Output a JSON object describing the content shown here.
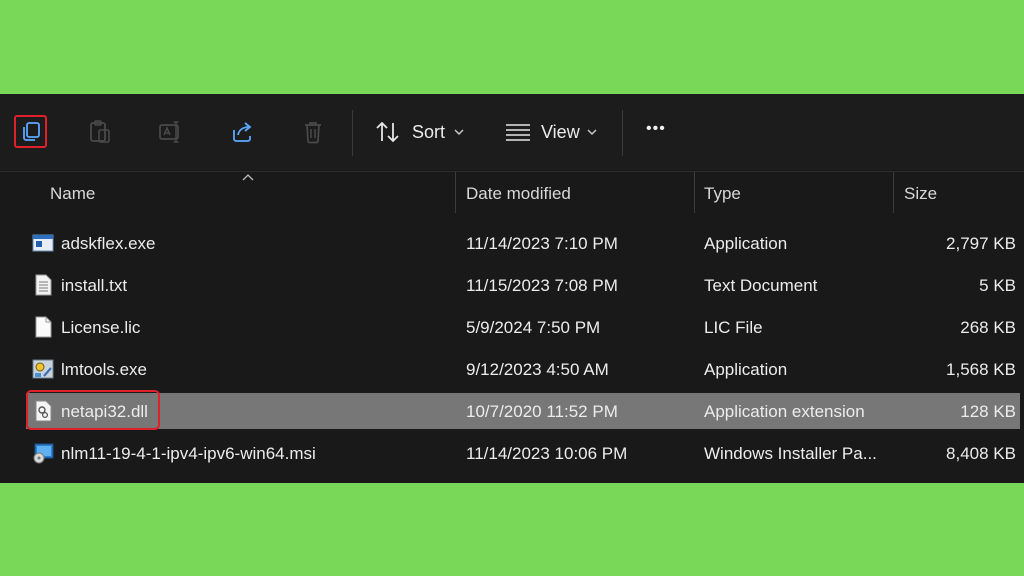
{
  "toolbar": {
    "buttons": [
      "copy-icon",
      "paste-icon",
      "rename-icon",
      "share-icon",
      "delete-icon"
    ],
    "sort_label": "Sort",
    "view_label": "View",
    "more_label": "•••"
  },
  "columns": {
    "name": "Name",
    "date": "Date modified",
    "type": "Type",
    "size": "Size"
  },
  "files": [
    {
      "name": "adskflex.exe",
      "date": "11/14/2023 7:10 PM",
      "type": "Application",
      "size": "2,797 KB",
      "icon": "exe-window-icon"
    },
    {
      "name": "install.txt",
      "date": "11/15/2023 7:08 PM",
      "type": "Text Document",
      "size": "5 KB",
      "icon": "text-file-icon"
    },
    {
      "name": "License.lic",
      "date": "5/9/2024 7:50 PM",
      "type": "LIC File",
      "size": "268 KB",
      "icon": "blank-file-icon"
    },
    {
      "name": "lmtools.exe",
      "date": "9/12/2023 4:50 AM",
      "type": "Application",
      "size": "1,568 KB",
      "icon": "tools-app-icon"
    },
    {
      "name": "netapi32.dll",
      "date": "10/7/2020 11:52 PM",
      "type": "Application extension",
      "size": "128 KB",
      "icon": "dll-gear-icon",
      "selected": true
    },
    {
      "name": "nlm11-19-4-1-ipv4-ipv6-win64.msi",
      "date": "11/14/2023 10:06 PM",
      "type": "Windows Installer Pa...",
      "size": "8,408 KB",
      "icon": "msi-installer-icon"
    }
  ],
  "colors": {
    "background_green": "#7ad858",
    "panel": "#191919",
    "highlight_red": "#e0202a",
    "selected_row": "#777777"
  }
}
